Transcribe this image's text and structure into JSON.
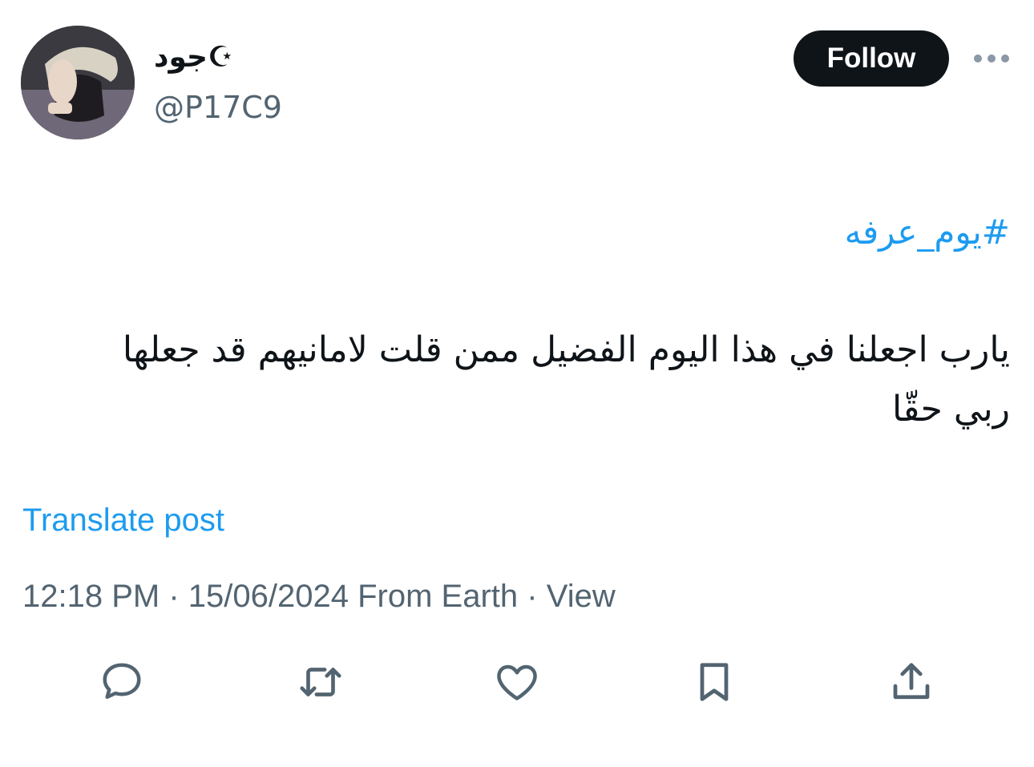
{
  "author": {
    "display_name": "جود☪",
    "handle": "@P17C9"
  },
  "header": {
    "follow_label": "Follow",
    "more_icon": "more-horizontal-icon"
  },
  "post": {
    "hashtag": "#يوم_عرفه",
    "text": "يارب اجعلنا في هذا اليوم الفضيل ممن قلت لامانيهم قد جعلها ربي حقّا",
    "translate_label": "Translate post",
    "time": "12:18 PM",
    "separator": "·",
    "date": "15/06/2024",
    "source": "From Earth",
    "views_label": "View"
  },
  "actions": [
    {
      "name": "reply",
      "icon": "reply-icon"
    },
    {
      "name": "repost",
      "icon": "repost-icon"
    },
    {
      "name": "like",
      "icon": "heart-icon"
    },
    {
      "name": "bookmark",
      "icon": "bookmark-icon"
    },
    {
      "name": "share",
      "icon": "share-icon"
    }
  ],
  "colors": {
    "link": "#1d9bf0",
    "secondary_text": "#536471",
    "primary_text": "#0f1419",
    "button_bg": "#0f1419"
  }
}
